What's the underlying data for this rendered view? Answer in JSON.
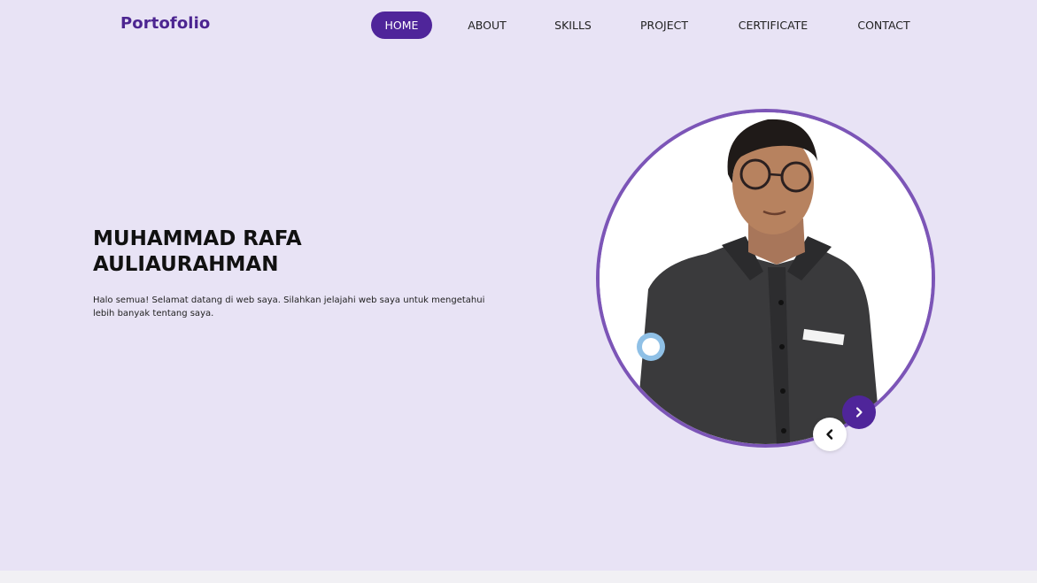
{
  "header": {
    "logo": "Portofolio"
  },
  "nav": {
    "items": [
      {
        "label": "HOME",
        "active": true
      },
      {
        "label": "ABOUT",
        "active": false
      },
      {
        "label": "SKILLS",
        "active": false
      },
      {
        "label": "PROJECT",
        "active": false
      },
      {
        "label": "CERTIFICATE",
        "active": false
      },
      {
        "label": "CONTACT",
        "active": false
      }
    ]
  },
  "hero": {
    "name_line1": "MUHAMMAD RAFA",
    "name_line2": "AULIAURAHMAN",
    "description": "Halo semua! Selamat datang di web saya. Silahkan jelajahi web saya untuk mengetahui lebih banyak tentang saya."
  },
  "carousel": {
    "prev_icon": "chevron-left-icon",
    "next_icon": "chevron-right-icon"
  },
  "colors": {
    "accent": "#4f259a",
    "ring": "#7c55b7",
    "background": "#e8e3f5"
  }
}
